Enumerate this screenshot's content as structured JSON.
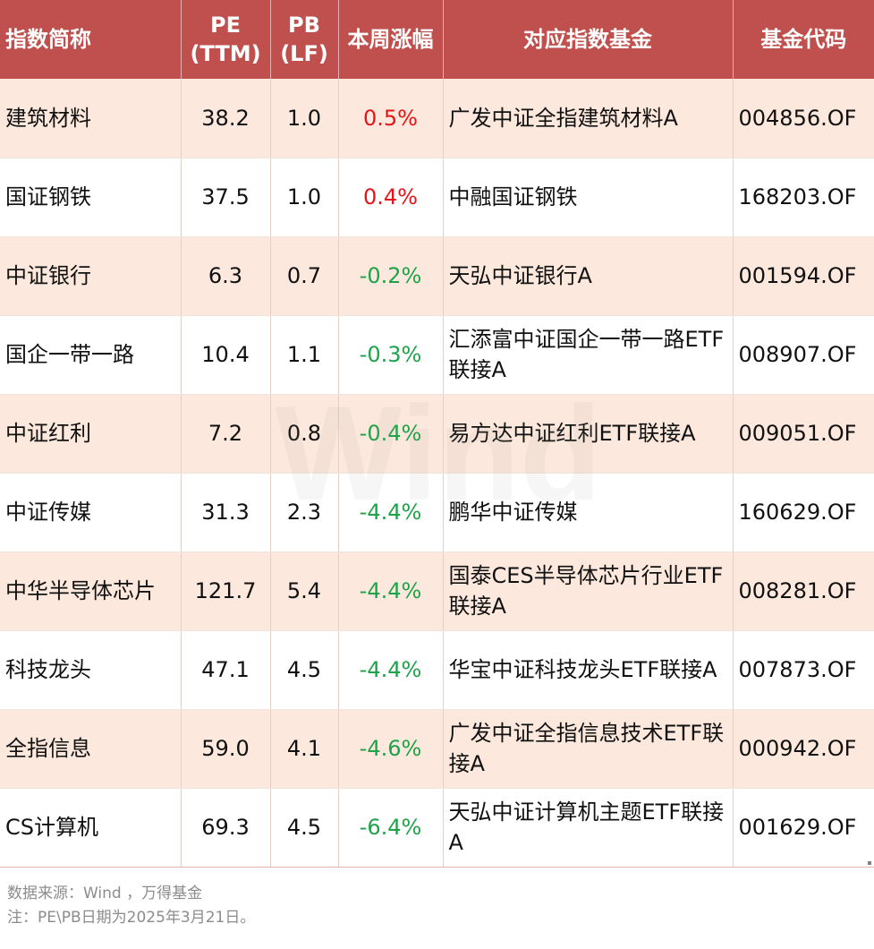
{
  "table": {
    "headers": [
      {
        "line1": "指数简称",
        "line2": ""
      },
      {
        "line1": "PE",
        "line2": "(TTM)"
      },
      {
        "line1": "PB",
        "line2": "(LF)"
      },
      {
        "line1": "本周涨幅",
        "line2": ""
      },
      {
        "line1": "对应指数基金",
        "line2": ""
      },
      {
        "line1": "基金代码",
        "line2": ""
      }
    ],
    "rows": [
      {
        "name": "建筑材料",
        "pe": "38.2",
        "pb": "1.0",
        "change": "0.5%",
        "direction": "up",
        "fund": "广发中证全指建筑材料A",
        "code": "004856.OF"
      },
      {
        "name": "国证钢铁",
        "pe": "37.5",
        "pb": "1.0",
        "change": "0.4%",
        "direction": "up",
        "fund": "中融国证钢铁",
        "code": "168203.OF"
      },
      {
        "name": "中证银行",
        "pe": "6.3",
        "pb": "0.7",
        "change": "-0.2%",
        "direction": "down",
        "fund": "天弘中证银行A",
        "code": "001594.OF"
      },
      {
        "name": "国企一带一路",
        "pe": "10.4",
        "pb": "1.1",
        "change": "-0.3%",
        "direction": "down",
        "fund": "汇添富中证国企一带一路ETF联接A",
        "code": "008907.OF"
      },
      {
        "name": "中证红利",
        "pe": "7.2",
        "pb": "0.8",
        "change": "-0.4%",
        "direction": "down",
        "fund": "易方达中证红利ETF联接A",
        "code": "009051.OF"
      },
      {
        "name": "中证传媒",
        "pe": "31.3",
        "pb": "2.3",
        "change": "-4.4%",
        "direction": "down",
        "fund": "鹏华中证传媒",
        "code": "160629.OF"
      },
      {
        "name": "中华半导体芯片",
        "pe": "121.7",
        "pb": "5.4",
        "change": "-4.4%",
        "direction": "down",
        "fund": "国泰CES半导体芯片行业ETF联接A",
        "code": "008281.OF"
      },
      {
        "name": "科技龙头",
        "pe": "47.1",
        "pb": "4.5",
        "change": "-4.4%",
        "direction": "down",
        "fund": "华宝中证科技龙头ETF联接A",
        "code": "007873.OF"
      },
      {
        "name": "全指信息",
        "pe": "59.0",
        "pb": "4.1",
        "change": "-4.6%",
        "direction": "down",
        "fund": "广发中证全指信息技术ETF联接A",
        "code": "000942.OF"
      },
      {
        "name": "CS计算机",
        "pe": "69.3",
        "pb": "4.5",
        "change": "-6.4%",
        "direction": "down",
        "fund": "天弘中证计算机主题ETF联接A",
        "code": "001629.OF"
      }
    ]
  },
  "watermark": {
    "text": "Wind"
  },
  "footer": {
    "source": "数据来源：Wind ，万得基金",
    "note": "注：PE\\PB日期为2025年3月21日。"
  },
  "colors": {
    "header_bg": "#c0504d",
    "row_alt_bg": "#fce8dc",
    "up": "#e3151a",
    "down": "#1ea34a"
  }
}
